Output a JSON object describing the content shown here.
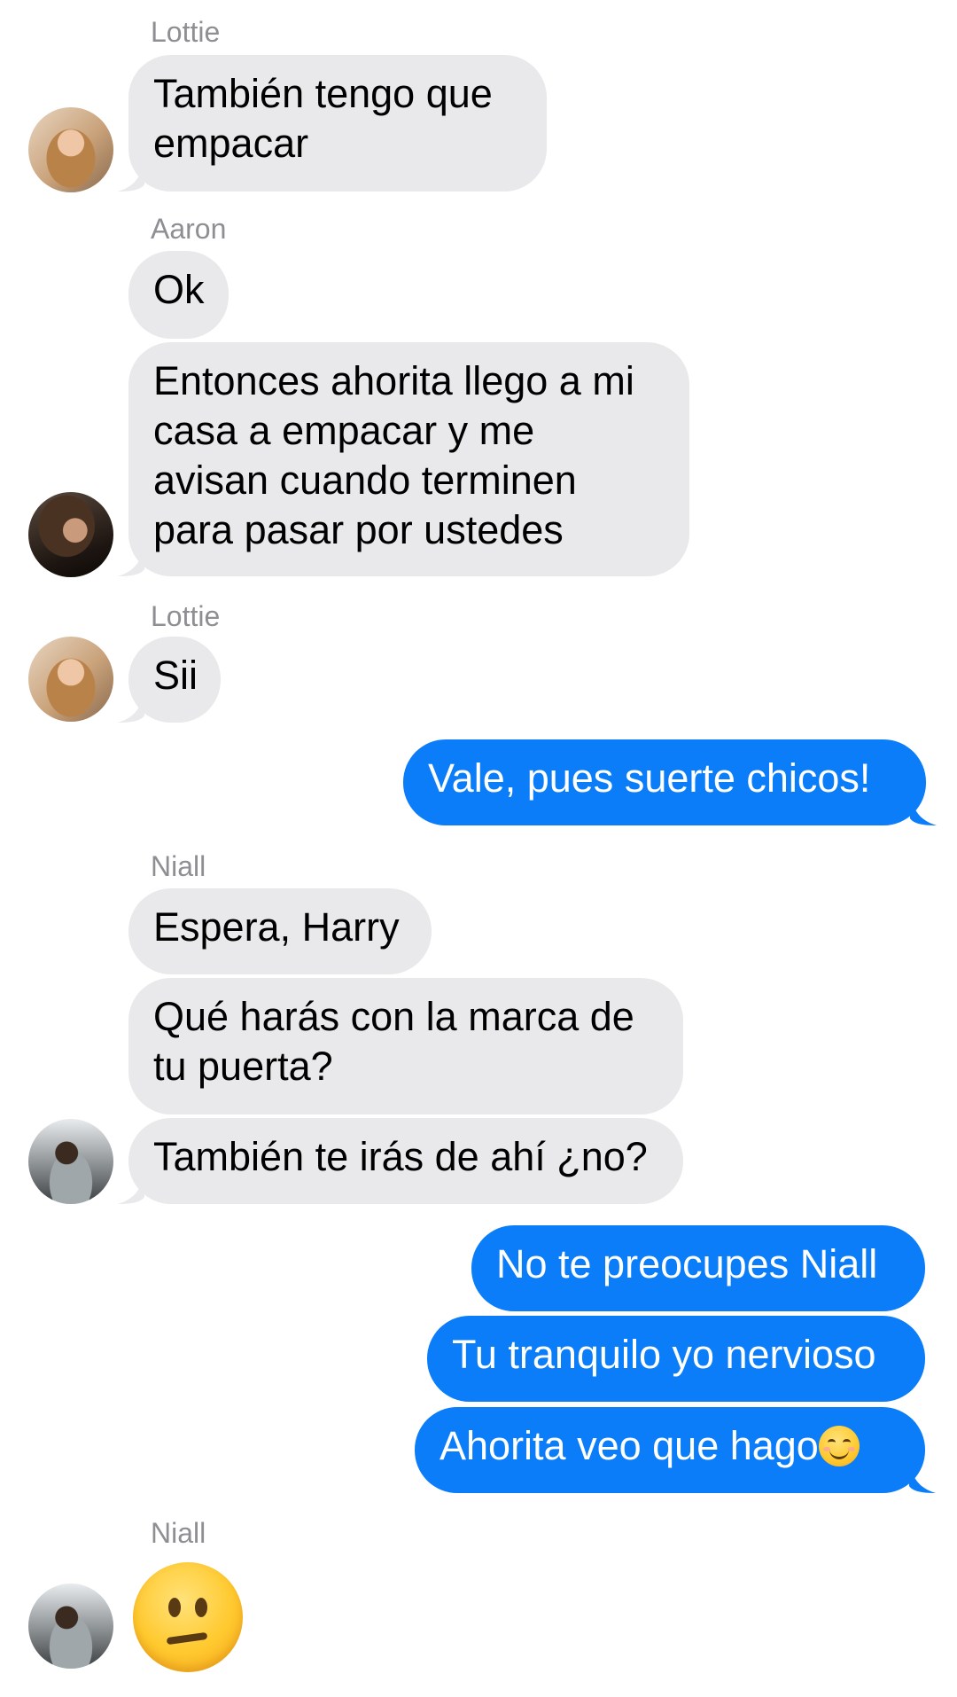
{
  "colors": {
    "incoming_bubble": "#e9e9eb",
    "outgoing_bubble": "#0b7df8",
    "sender_name": "#8e8e93"
  },
  "messages": [
    {
      "sender": "Lottie",
      "text_lines": [
        "También tengo que",
        "empacar"
      ]
    },
    {
      "sender": "Aaron",
      "text": "Ok"
    },
    {
      "text_lines": [
        "Entonces ahorita llego a mi",
        "casa a empacar y me",
        "avisan cuando terminen",
        "para pasar por ustedes"
      ]
    },
    {
      "sender": "Lottie",
      "text": "Sii"
    },
    {
      "outgoing": true,
      "text": "Vale, pues suerte chicos!"
    },
    {
      "sender": "Niall",
      "text": "Espera, Harry"
    },
    {
      "text_lines": [
        "Qué harás con la marca de",
        "tu puerta?"
      ]
    },
    {
      "text": "También te irás de ahí ¿no?"
    },
    {
      "outgoing": true,
      "text": "No te preocupes Niall"
    },
    {
      "outgoing": true,
      "text": "Tu tranquilo yo nervioso"
    },
    {
      "outgoing": true,
      "text": "Ahorita veo que hago",
      "emoji": "smiling-face-icon"
    },
    {
      "sender": "Niall",
      "emoji": "confused-face-icon"
    }
  ]
}
